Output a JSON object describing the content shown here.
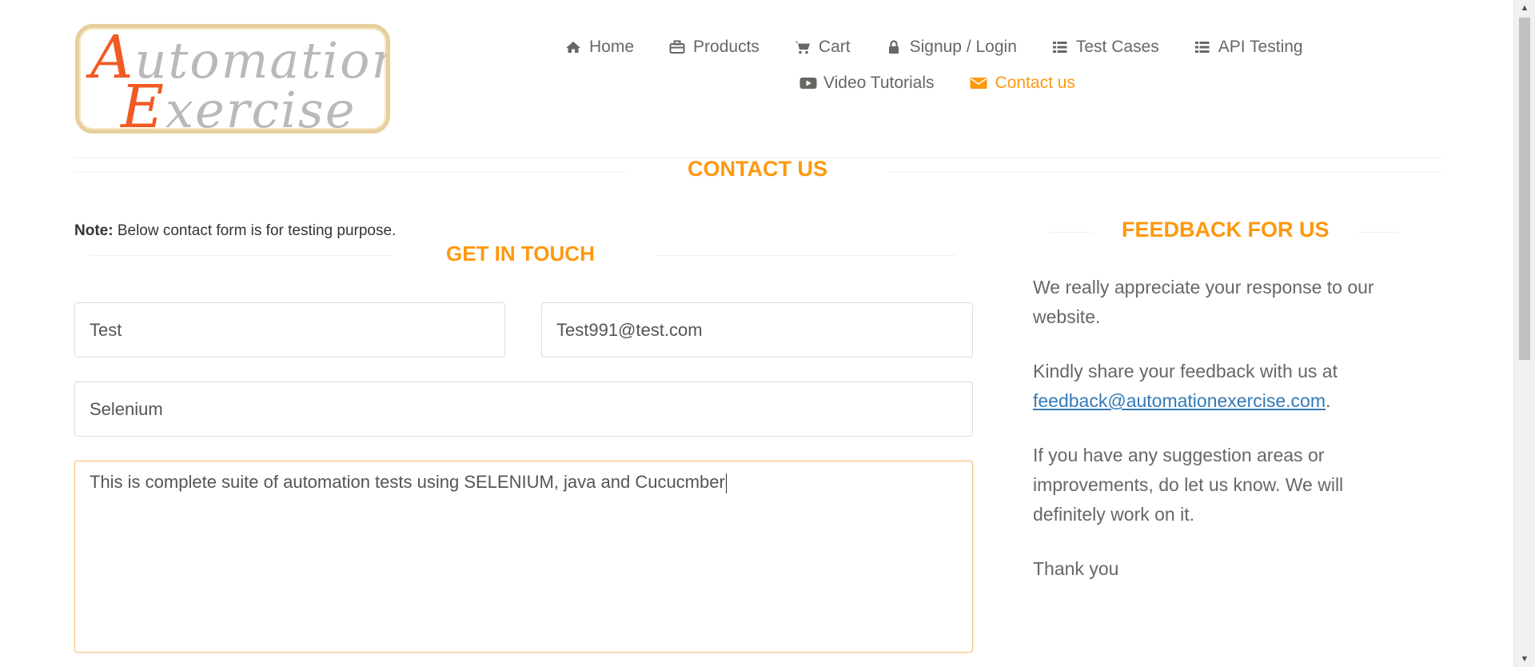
{
  "logo": {
    "line1_big": "A",
    "line1_rest": "utomation",
    "line2_big": "E",
    "line2_rest": "xercise"
  },
  "nav": [
    {
      "label": "Home",
      "icon": "home-icon"
    },
    {
      "label": "Products",
      "icon": "briefcase-icon"
    },
    {
      "label": "Cart",
      "icon": "cart-icon"
    },
    {
      "label": "Signup / Login",
      "icon": "lock-icon"
    },
    {
      "label": "Test Cases",
      "icon": "list-icon"
    },
    {
      "label": "API Testing",
      "icon": "list-icon"
    },
    {
      "label": "Video Tutorials",
      "icon": "youtube-play-icon"
    },
    {
      "label": "Contact us",
      "icon": "envelope-icon",
      "active": true
    }
  ],
  "page_title": "Contact Us",
  "note": {
    "bold": "Note:",
    "text": " Below contact form is for testing purpose."
  },
  "get_in_touch": "Get In Touch",
  "form": {
    "name_value": "Test",
    "email_value": "Test991@test.com",
    "subject_value": "Selenium",
    "message_value": "This is complete suite of automation tests using SELENIUM, java and Cucucmber"
  },
  "feedback": {
    "title": "Feedback For Us",
    "p1": "We really appreciate your response to our website.",
    "p2_prefix": "Kindly share your feedback with us at",
    "p2_link": "feedback@automationexercise.com",
    "p2_suffix": ".",
    "p3": "If you have any suggestion areas or improvements, do let us know. We will definitely work on it.",
    "p4": "Thank you"
  },
  "colors": {
    "accent": "#fe980f",
    "link": "#337ab7",
    "text": "#696763"
  }
}
